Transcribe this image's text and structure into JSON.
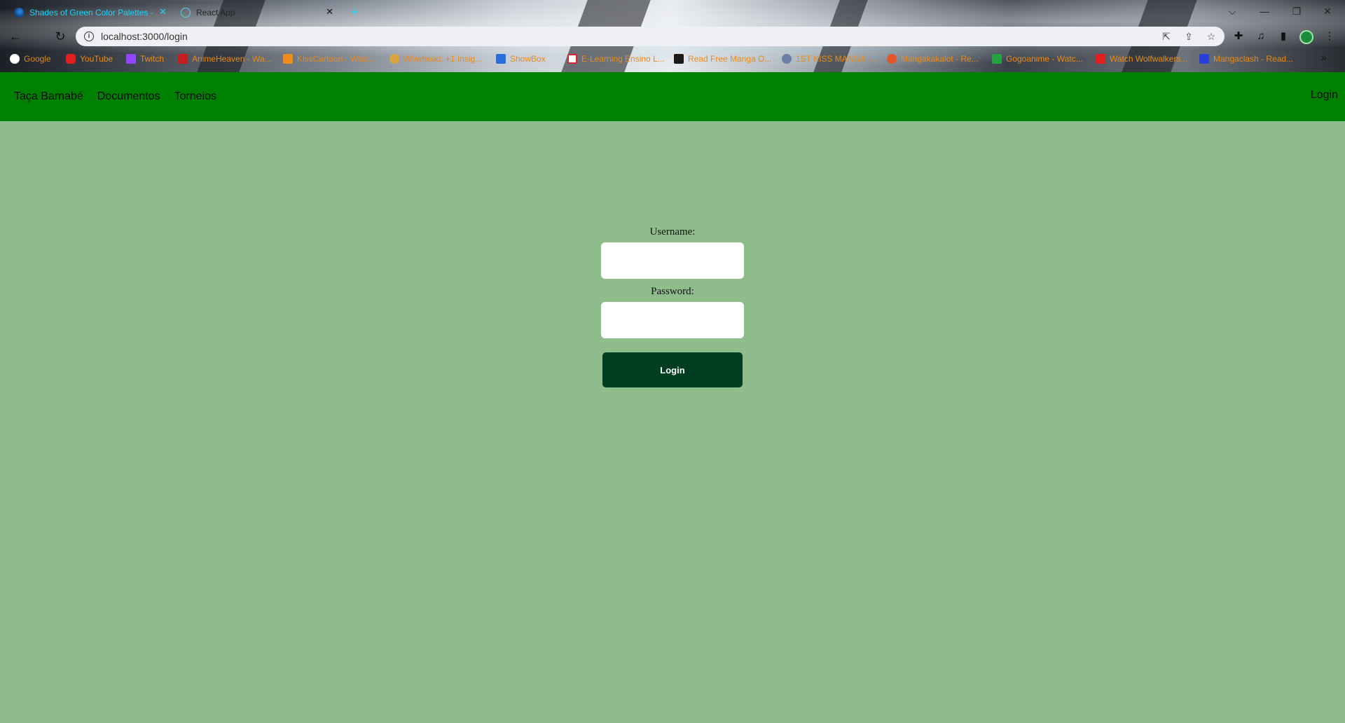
{
  "browser": {
    "tabs": [
      {
        "title": "Shades of Green Color Palettes - ",
        "icon": "palette-favicon"
      },
      {
        "title": "React App",
        "icon": "react-favicon"
      }
    ],
    "new_tab_label": "+",
    "window_controls": {
      "chevron": "⌵",
      "minimize": "—",
      "restore": "❐",
      "close": "✕"
    },
    "url": "localhost:3000/login",
    "bookmarks": [
      {
        "label": "Google",
        "icon": "google-icon",
        "color": "#ffffff"
      },
      {
        "label": "YouTube",
        "icon": "youtube-icon",
        "color": "#e02020"
      },
      {
        "label": "Twitch",
        "icon": "twitch-icon",
        "color": "#9146ff"
      },
      {
        "label": "AnimeHeaven - Wa...",
        "icon": "animeheaven-icon",
        "color": "#c41e1e"
      },
      {
        "label": "KissCartoon - Watc...",
        "icon": "kisscartoon-icon",
        "color": "#f08a1a"
      },
      {
        "label": "Wowhead: +1 Insig...",
        "icon": "wowhead-icon",
        "color": "#d9a441"
      },
      {
        "label": "ShowBox",
        "icon": "showbox-icon",
        "color": "#2a6fd8"
      },
      {
        "label": "E-Learning Ensino L...",
        "icon": "elearning-icon",
        "color": "#d42a2a"
      },
      {
        "label": "Read Free Manga O...",
        "icon": "manga-icon",
        "color": "#1a1a1a"
      },
      {
        "label": "1ST KISS MANGA -...",
        "icon": "kissmanga-icon",
        "color": "#6b7ea6"
      },
      {
        "label": "Mangakakalot - Re...",
        "icon": "mangakakalot-icon",
        "color": "#e2572a"
      },
      {
        "label": "Gogoanime - Watc...",
        "icon": "gogoanime-icon",
        "color": "#25a244"
      },
      {
        "label": "Watch Wolfwalkers...",
        "icon": "wolfwalkers-icon",
        "color": "#e02020"
      },
      {
        "label": "Mangaclash - Read...",
        "icon": "mangaclash-icon",
        "color": "#2a3fd8"
      }
    ],
    "bookmarks_more": "»"
  },
  "navbar": {
    "brand": "Taça Barnabé",
    "links": [
      "Documentos",
      "Torneios"
    ],
    "login": "Login"
  },
  "form": {
    "username_label": "Username:",
    "password_label": "Password:",
    "submit_label": "Login"
  },
  "colors": {
    "page_background": "#8fbc8b",
    "navbar": "#008000",
    "button": "#003d21"
  }
}
